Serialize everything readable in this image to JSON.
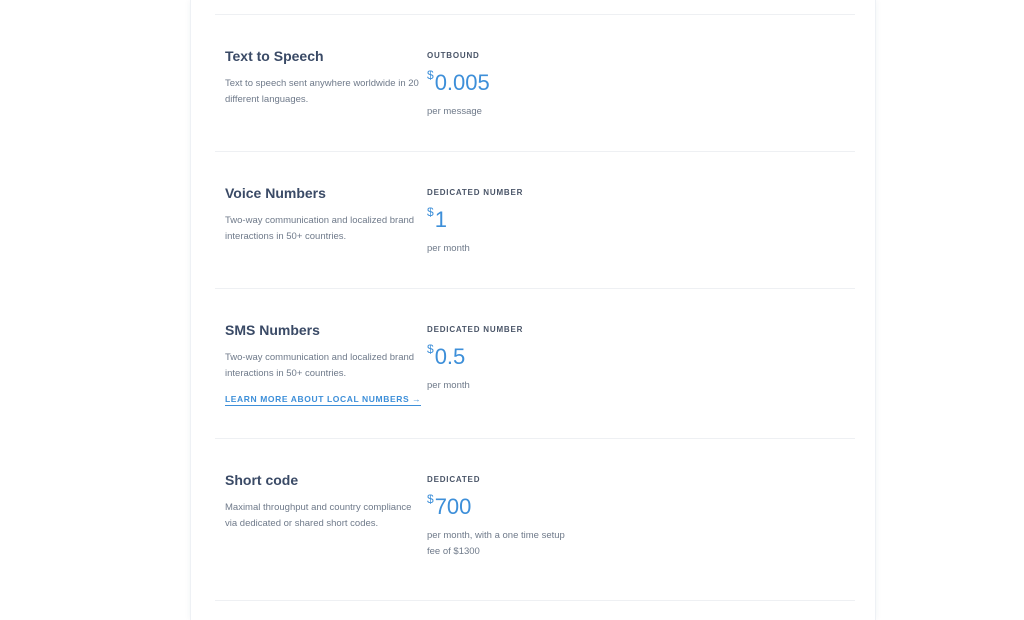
{
  "pricing": {
    "text_to_speech": {
      "name": "Text to Speech",
      "description": "Text to speech sent anywhere worldwide in 20 different languages.",
      "label": "OUTBOUND",
      "currency": "$",
      "amount": "0.005",
      "unit": "per message"
    },
    "voice_numbers": {
      "name": "Voice Numbers",
      "description": "Two-way communication and localized brand interactions in 50+ countries.",
      "label": "DEDICATED NUMBER",
      "currency": "$",
      "amount": "1",
      "unit": "per month"
    },
    "sms_numbers": {
      "name": "SMS Numbers",
      "description": "Two-way communication and localized brand interactions in 50+ countries.",
      "link": "LEARN MORE ABOUT LOCAL NUMBERS →",
      "label": "DEDICATED NUMBER",
      "currency": "$",
      "amount": "0.5",
      "unit": "per month"
    },
    "short_code": {
      "name": "Short code",
      "description": "Maximal throughput and country compliance via dedicated or shared short codes.",
      "label": "DEDICATED",
      "currency": "$",
      "amount": "700",
      "unit": "per month, with a one time setup fee of $1300"
    }
  },
  "colors": {
    "accent": "#3d8fd9",
    "heading": "#3a4a66",
    "body_text": "#6f7a8a"
  }
}
